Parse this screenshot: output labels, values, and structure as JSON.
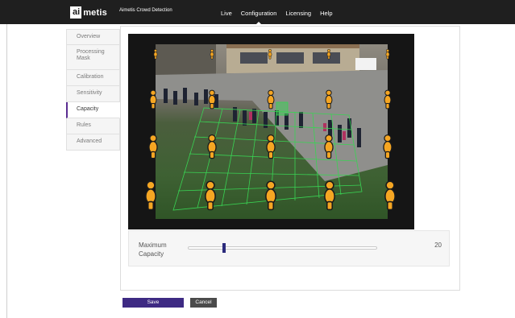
{
  "header": {
    "logo_prefix": "ai",
    "logo_suffix": "metis",
    "app_title": "Aimetis Crowd Detection",
    "nav": [
      "Live",
      "Configuration",
      "Licensing",
      "Help"
    ],
    "active_nav": "Configuration"
  },
  "tabs": [
    "Overview",
    "Processing Mask",
    "Calibration",
    "Sensitivity",
    "Capacity",
    "Rules",
    "Advanced"
  ],
  "active_tab": "Capacity",
  "capacity": {
    "label": "Maximum Capacity",
    "value": "20",
    "slider_fraction": 0.19
  },
  "buttons": {
    "save": "Save",
    "cancel": "Cancel"
  },
  "colors": {
    "figure_fill": "#f5a623",
    "grid_line": "#39d353",
    "accent": "#5a2d91",
    "save_button": "#3e2a83"
  },
  "icons": [
    "person-marker-icon"
  ]
}
